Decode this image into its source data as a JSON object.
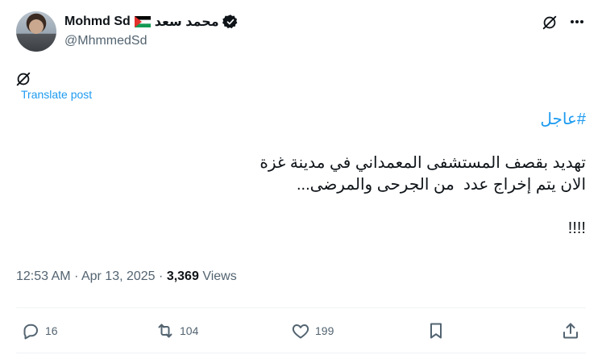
{
  "author": {
    "display_name": "Mohmd Sd",
    "arabic_name": "محمد سعد",
    "handle": "@MhmmedSd"
  },
  "icons": {
    "avatar": "avatar-photo",
    "flag": "palestine-flag",
    "verified": "verified-badge-icon",
    "grok": "grok-icon",
    "more": "more-icon",
    "reply": "reply-icon",
    "repost": "repost-icon",
    "like": "like-icon",
    "bookmark": "bookmark-icon",
    "share": "share-icon"
  },
  "translate_label": "Translate post",
  "post": {
    "hashtag": "#عاجل",
    "line1": "تهديد بقصف المستشفى المعمداني في مدينة غزة",
    "line2": "الان يتم إخراج عدد  من الجرحى والمرضى...",
    "line3": "!!!!"
  },
  "meta": {
    "time": "12:53 AM",
    "separator": "·",
    "date": "Apr 13, 2025",
    "separator2": "·",
    "views_count": "3,369",
    "views_label": "Views"
  },
  "actions": {
    "replies": "16",
    "reposts": "104",
    "likes": "199"
  },
  "colors": {
    "link": "#1d9bf0",
    "secondary_text": "#536471",
    "primary_text": "#0f1419"
  }
}
